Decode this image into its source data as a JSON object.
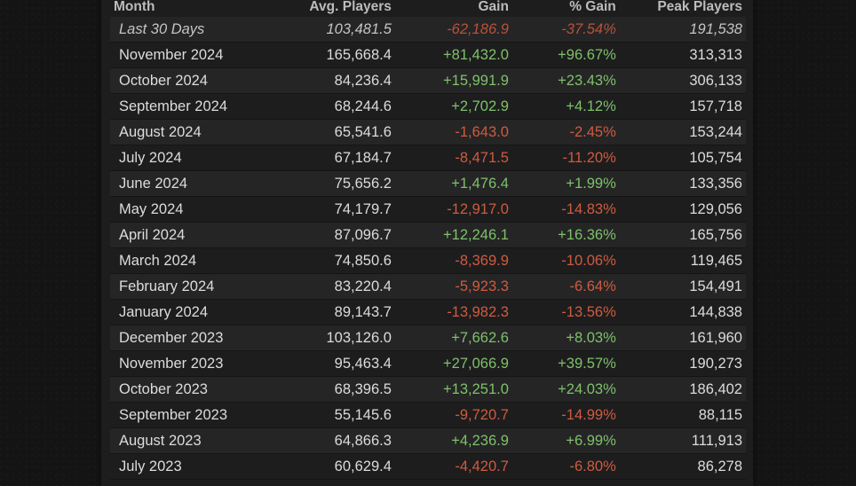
{
  "table": {
    "headers": {
      "month": "Month",
      "avg_players": "Avg. Players",
      "gain": "Gain",
      "pct_gain": "% Gain",
      "peak_players": "Peak Players"
    },
    "rows": [
      {
        "month": "Last 30 Days",
        "avg": "103,481.5",
        "gain": "-62,186.9",
        "pct": "-37.54%",
        "peak": "191,538"
      },
      {
        "month": "November 2024",
        "avg": "165,668.4",
        "gain": "+81,432.0",
        "pct": "+96.67%",
        "peak": "313,313"
      },
      {
        "month": "October 2024",
        "avg": "84,236.4",
        "gain": "+15,991.9",
        "pct": "+23.43%",
        "peak": "306,133"
      },
      {
        "month": "September 2024",
        "avg": "68,244.6",
        "gain": "+2,702.9",
        "pct": "+4.12%",
        "peak": "157,718"
      },
      {
        "month": "August 2024",
        "avg": "65,541.6",
        "gain": "-1,643.0",
        "pct": "-2.45%",
        "peak": "153,244"
      },
      {
        "month": "July 2024",
        "avg": "67,184.7",
        "gain": "-8,471.5",
        "pct": "-11.20%",
        "peak": "105,754"
      },
      {
        "month": "June 2024",
        "avg": "75,656.2",
        "gain": "+1,476.4",
        "pct": "+1.99%",
        "peak": "133,356"
      },
      {
        "month": "May 2024",
        "avg": "74,179.7",
        "gain": "-12,917.0",
        "pct": "-14.83%",
        "peak": "129,056"
      },
      {
        "month": "April 2024",
        "avg": "87,096.7",
        "gain": "+12,246.1",
        "pct": "+16.36%",
        "peak": "165,756"
      },
      {
        "month": "March 2024",
        "avg": "74,850.6",
        "gain": "-8,369.9",
        "pct": "-10.06%",
        "peak": "119,465"
      },
      {
        "month": "February 2024",
        "avg": "83,220.4",
        "gain": "-5,923.3",
        "pct": "-6.64%",
        "peak": "154,491"
      },
      {
        "month": "January 2024",
        "avg": "89,143.7",
        "gain": "-13,982.3",
        "pct": "-13.56%",
        "peak": "144,838"
      },
      {
        "month": "December 2023",
        "avg": "103,126.0",
        "gain": "+7,662.6",
        "pct": "+8.03%",
        "peak": "161,960"
      },
      {
        "month": "November 2023",
        "avg": "95,463.4",
        "gain": "+27,066.9",
        "pct": "+39.57%",
        "peak": "190,273"
      },
      {
        "month": "October 2023",
        "avg": "68,396.5",
        "gain": "+13,251.0",
        "pct": "+24.03%",
        "peak": "186,402"
      },
      {
        "month": "September 2023",
        "avg": "55,145.6",
        "gain": "-9,720.7",
        "pct": "-14.99%",
        "peak": "88,115"
      },
      {
        "month": "August 2023",
        "avg": "64,866.3",
        "gain": "+4,236.9",
        "pct": "+6.99%",
        "peak": "111,913"
      },
      {
        "month": "July 2023",
        "avg": "60,629.4",
        "gain": "-4,420.7",
        "pct": "-6.80%",
        "peak": "86,278"
      }
    ]
  },
  "colors": {
    "positive": "#7fc16a",
    "negative": "#cf5b3f",
    "row_alt": "#252526",
    "row_base": "#1d1d1e",
    "page_bg": "#141414"
  }
}
